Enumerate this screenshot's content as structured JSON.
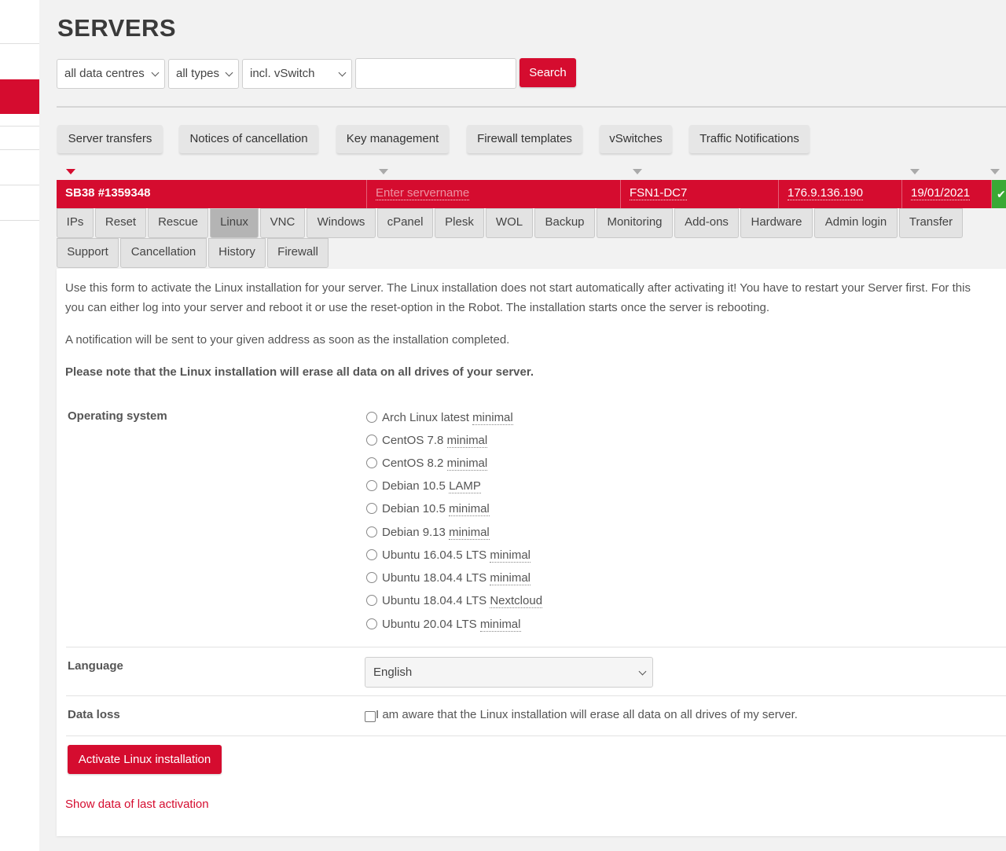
{
  "page": {
    "title": "SERVERS"
  },
  "filters": {
    "datacentre": "all data centres",
    "type": "all types",
    "vswitch": "incl. vSwitch",
    "search_value": "",
    "search_label": "Search"
  },
  "tools": [
    "Server transfers",
    "Notices of cancellation",
    "Key management",
    "Firewall templates",
    "vSwitches",
    "Traffic Notifications"
  ],
  "server": {
    "name": "SB38 #1359348",
    "servername_placeholder": "Enter servername",
    "datacentre": "FSN1-DC7",
    "ip": "176.9.136.190",
    "date": "19/01/2021",
    "status_icon": "check-icon"
  },
  "tabs": [
    "IPs",
    "Reset",
    "Rescue",
    "Linux",
    "VNC",
    "Windows",
    "cPanel",
    "Plesk",
    "WOL",
    "Backup",
    "Monitoring",
    "Add-ons",
    "Hardware",
    "Admin login",
    "Transfer",
    "Support",
    "Cancellation",
    "History",
    "Firewall"
  ],
  "active_tab": "Linux",
  "content": {
    "intro_line1": "Use this form to activate the Linux installation for your server. The Linux installation does not start automatically after activating it! You have to restart your Server first. For this",
    "intro_line2": "you can either log into your server and reboot it or use the reset-option in the Robot. The installation starts once the server is rebooting.",
    "notification": "A notification will be sent to your given address as soon as the installation completed.",
    "warning": "Please note that the Linux installation will erase all data on all drives of your server.",
    "os_label": "Operating system",
    "os_options": [
      {
        "name": "Arch Linux latest",
        "variant": "minimal"
      },
      {
        "name": "CentOS 7.8",
        "variant": "minimal"
      },
      {
        "name": "CentOS 8.2",
        "variant": "minimal"
      },
      {
        "name": "Debian 10.5",
        "variant": "LAMP"
      },
      {
        "name": "Debian 10.5",
        "variant": "minimal"
      },
      {
        "name": "Debian 9.13",
        "variant": "minimal"
      },
      {
        "name": "Ubuntu 16.04.5 LTS",
        "variant": "minimal"
      },
      {
        "name": "Ubuntu 18.04.4 LTS",
        "variant": "minimal"
      },
      {
        "name": "Ubuntu 18.04.4 LTS",
        "variant": "Nextcloud"
      },
      {
        "name": "Ubuntu 20.04 LTS",
        "variant": "minimal"
      }
    ],
    "language_label": "Language",
    "language_value": "English",
    "dataloss_label": "Data loss",
    "dataloss_text": "I am aware that the Linux installation will erase all data on all drives of my server.",
    "activate_label": "Activate Linux installation",
    "last_activation_label": "Show data of last activation"
  },
  "colors": {
    "accent": "#d50c2f",
    "success": "#3aa935"
  }
}
